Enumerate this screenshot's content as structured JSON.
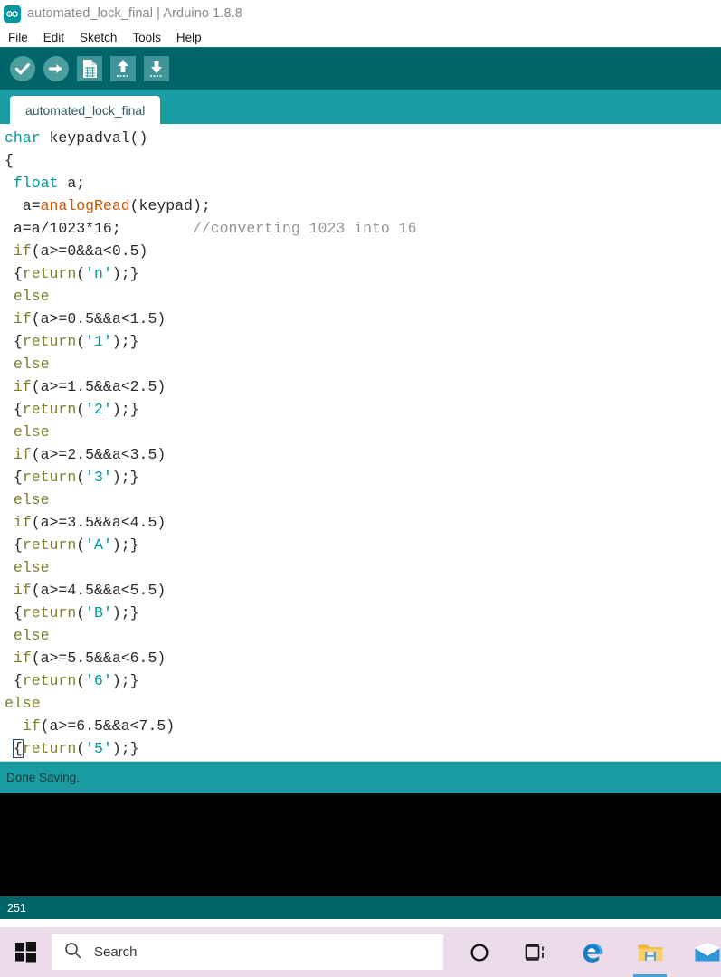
{
  "window": {
    "title": "automated_lock_final | Arduino 1.8.8",
    "logo_icon": "arduino-infinity-icon"
  },
  "menubar": {
    "items": [
      {
        "accel": "F",
        "rest": "ile",
        "name": "file"
      },
      {
        "accel": "E",
        "rest": "dit",
        "name": "edit"
      },
      {
        "accel": "S",
        "rest": "ketch",
        "name": "sketch"
      },
      {
        "accel": "T",
        "rest": "ools",
        "name": "tools"
      },
      {
        "accel": "H",
        "rest": "elp",
        "name": "help"
      }
    ]
  },
  "toolbar": {
    "buttons": [
      {
        "name": "verify-button",
        "icon": "checkmark-circle-icon",
        "label": "Verify"
      },
      {
        "name": "upload-button",
        "icon": "arrow-right-circle-icon",
        "label": "Upload"
      },
      {
        "name": "new-button",
        "icon": "new-document-icon",
        "label": "New"
      },
      {
        "name": "open-button",
        "icon": "arrow-up-icon",
        "label": "Open"
      },
      {
        "name": "save-button",
        "icon": "arrow-down-icon",
        "label": "Save"
      }
    ]
  },
  "tabs": [
    {
      "label": "automated_lock_final",
      "active": true
    }
  ],
  "editor": {
    "lines": [
      [
        {
          "t": "char ",
          "c": "kw-type"
        },
        {
          "t": "keypadval()",
          "c": ""
        }
      ],
      [
        {
          "t": "{",
          "c": ""
        }
      ],
      [
        {
          "t": " ",
          "c": ""
        },
        {
          "t": "float",
          "c": "kw-type"
        },
        {
          "t": " a;",
          "c": ""
        }
      ],
      [
        {
          "t": "  a=",
          "c": ""
        },
        {
          "t": "analogRead",
          "c": "fn"
        },
        {
          "t": "(keypad);",
          "c": ""
        }
      ],
      [
        {
          "t": " a=a/1023*16;        ",
          "c": ""
        },
        {
          "t": "//converting 1023 into 16",
          "c": "cmt"
        }
      ],
      [
        {
          "t": " ",
          "c": ""
        },
        {
          "t": "if",
          "c": "kw-ctrl"
        },
        {
          "t": "(a>=0&&a<0.5)",
          "c": ""
        }
      ],
      [
        {
          "t": " {",
          "c": ""
        },
        {
          "t": "return",
          "c": "kw-ctrl"
        },
        {
          "t": "(",
          "c": ""
        },
        {
          "t": "'n'",
          "c": "str"
        },
        {
          "t": ");}",
          "c": ""
        }
      ],
      [
        {
          "t": " ",
          "c": ""
        },
        {
          "t": "else",
          "c": "kw-ctrl"
        }
      ],
      [
        {
          "t": " ",
          "c": ""
        },
        {
          "t": "if",
          "c": "kw-ctrl"
        },
        {
          "t": "(a>=0.5&&a<1.5)",
          "c": ""
        }
      ],
      [
        {
          "t": " {",
          "c": ""
        },
        {
          "t": "return",
          "c": "kw-ctrl"
        },
        {
          "t": "(",
          "c": ""
        },
        {
          "t": "'1'",
          "c": "str"
        },
        {
          "t": ");}",
          "c": ""
        }
      ],
      [
        {
          "t": " ",
          "c": ""
        },
        {
          "t": "else",
          "c": "kw-ctrl"
        }
      ],
      [
        {
          "t": " ",
          "c": ""
        },
        {
          "t": "if",
          "c": "kw-ctrl"
        },
        {
          "t": "(a>=1.5&&a<2.5)",
          "c": ""
        }
      ],
      [
        {
          "t": " {",
          "c": ""
        },
        {
          "t": "return",
          "c": "kw-ctrl"
        },
        {
          "t": "(",
          "c": ""
        },
        {
          "t": "'2'",
          "c": "str"
        },
        {
          "t": ");}",
          "c": ""
        }
      ],
      [
        {
          "t": " ",
          "c": ""
        },
        {
          "t": "else",
          "c": "kw-ctrl"
        }
      ],
      [
        {
          "t": " ",
          "c": ""
        },
        {
          "t": "if",
          "c": "kw-ctrl"
        },
        {
          "t": "(a>=2.5&&a<3.5)",
          "c": ""
        }
      ],
      [
        {
          "t": " {",
          "c": ""
        },
        {
          "t": "return",
          "c": "kw-ctrl"
        },
        {
          "t": "(",
          "c": ""
        },
        {
          "t": "'3'",
          "c": "str"
        },
        {
          "t": ");}",
          "c": ""
        }
      ],
      [
        {
          "t": " ",
          "c": ""
        },
        {
          "t": "else",
          "c": "kw-ctrl"
        }
      ],
      [
        {
          "t": " ",
          "c": ""
        },
        {
          "t": "if",
          "c": "kw-ctrl"
        },
        {
          "t": "(a>=3.5&&a<4.5)",
          "c": ""
        }
      ],
      [
        {
          "t": " {",
          "c": ""
        },
        {
          "t": "return",
          "c": "kw-ctrl"
        },
        {
          "t": "(",
          "c": ""
        },
        {
          "t": "'A'",
          "c": "str"
        },
        {
          "t": ");}",
          "c": ""
        }
      ],
      [
        {
          "t": " ",
          "c": ""
        },
        {
          "t": "else",
          "c": "kw-ctrl"
        }
      ],
      [
        {
          "t": " ",
          "c": ""
        },
        {
          "t": "if",
          "c": "kw-ctrl"
        },
        {
          "t": "(a>=4.5&&a<5.5)",
          "c": ""
        }
      ],
      [
        {
          "t": " {",
          "c": ""
        },
        {
          "t": "return",
          "c": "kw-ctrl"
        },
        {
          "t": "(",
          "c": ""
        },
        {
          "t": "'B'",
          "c": "str"
        },
        {
          "t": ");}",
          "c": ""
        }
      ],
      [
        {
          "t": " ",
          "c": ""
        },
        {
          "t": "else",
          "c": "kw-ctrl"
        }
      ],
      [
        {
          "t": " ",
          "c": ""
        },
        {
          "t": "if",
          "c": "kw-ctrl"
        },
        {
          "t": "(a>=5.5&&a<6.5)",
          "c": ""
        }
      ],
      [
        {
          "t": " {",
          "c": ""
        },
        {
          "t": "return",
          "c": "kw-ctrl"
        },
        {
          "t": "(",
          "c": ""
        },
        {
          "t": "'6'",
          "c": "str"
        },
        {
          "t": ");}",
          "c": ""
        }
      ],
      [
        {
          "t": "else",
          "c": "kw-ctrl"
        }
      ],
      [
        {
          "t": "  ",
          "c": ""
        },
        {
          "t": "if",
          "c": "kw-ctrl"
        },
        {
          "t": "(a>=6.5&&a<7.5)",
          "c": ""
        }
      ],
      [
        {
          "t": " ",
          "c": ""
        },
        {
          "t": "{",
          "c": "brace-hl"
        },
        {
          "t": "return",
          "c": "kw-ctrl"
        },
        {
          "t": "(",
          "c": ""
        },
        {
          "t": "'5'",
          "c": "str"
        },
        {
          "t": ");}",
          "c": ""
        }
      ]
    ]
  },
  "status": {
    "message": "Done Saving."
  },
  "console": {
    "text": ""
  },
  "bottombar": {
    "line_number": "251"
  },
  "taskbar": {
    "start": {
      "icon": "windows-logo-icon",
      "label": "Start"
    },
    "search": {
      "placeholder": "Search",
      "icon": "search-icon"
    },
    "icons": [
      {
        "name": "cortana-icon",
        "label": "Cortana",
        "active": false
      },
      {
        "name": "task-view-icon",
        "label": "Task View",
        "active": false
      },
      {
        "name": "edge-icon",
        "label": "Microsoft Edge",
        "active": false
      },
      {
        "name": "file-explorer-icon",
        "label": "File Explorer",
        "active": true
      },
      {
        "name": "mail-icon",
        "label": "Mail",
        "active": false
      }
    ]
  },
  "colors": {
    "toolbar_bg": "#006468",
    "tabbar_bg": "#1a9ea3",
    "status_bg": "#1a9ba1",
    "console_bg": "#000000",
    "taskbar_bg": "#ecdbe9",
    "accent": "#00979c"
  }
}
